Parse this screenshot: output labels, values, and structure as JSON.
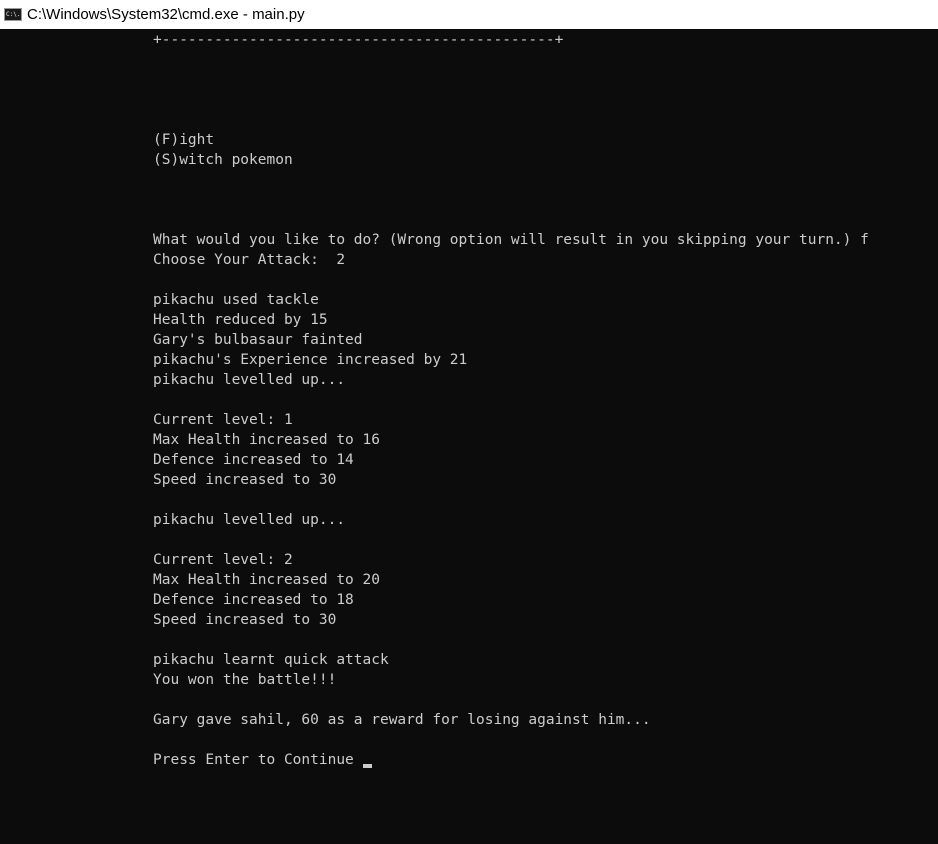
{
  "window": {
    "title": "C:\\Windows\\System32\\cmd.exe - main.py",
    "icon": "cmd-app-icon",
    "icon_glyph": "C:\\."
  },
  "console": {
    "lines": [
      "+---------------------------------------------+",
      "(F)ight",
      "(S)witch pokemon",
      "What would you like to do? (Wrong option will result in you skipping your turn.) f",
      "Choose Your Attack:  2",
      "pikachu used tackle",
      "Health reduced by 15",
      "Gary's bulbasaur fainted",
      "pikachu's Experience increased by 21",
      "pikachu levelled up...",
      "Current level: 1",
      "Max Health increased to 16",
      "Defence increased to 14",
      "Speed increased to 30",
      "pikachu levelled up...",
      "Current level: 2",
      "Max Health increased to 20",
      "Defence increased to 18",
      "Speed increased to 30",
      "pikachu learnt quick attack",
      "You won the battle!!!",
      "Gary gave sahil, 60 as a reward for losing against him...",
      "Press Enter to Continue"
    ]
  },
  "colors": {
    "background": "#0c0c0c",
    "text": "#cccccc",
    "titlebar": "#ffffff"
  }
}
